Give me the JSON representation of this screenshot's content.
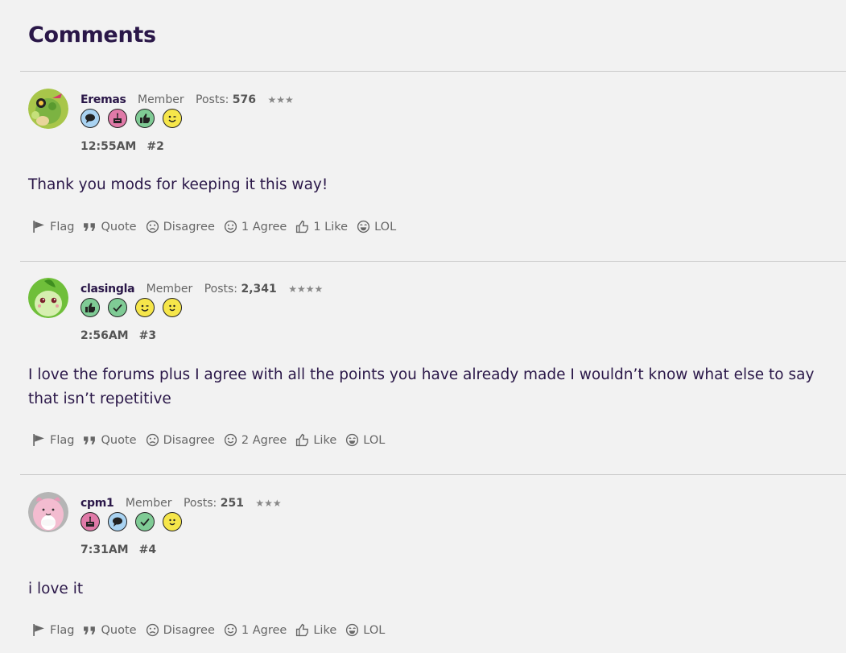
{
  "heading": "Comments",
  "comments": [
    {
      "username": "Eremas",
      "role": "Member",
      "posts_label": "Posts:",
      "posts_count": "576",
      "stars": "★★★",
      "badges": [
        "speech-bubble-icon",
        "cake-icon",
        "thumbs-up-icon",
        "wink-icon"
      ],
      "time": "12:55AM",
      "number": "#2",
      "body": "Thank you mods for keeping it this way!",
      "actions": {
        "flag": "Flag",
        "quote": "Quote",
        "disagree": "Disagree",
        "agree": "1 Agree",
        "like": "1 Like",
        "lol": "LOL"
      }
    },
    {
      "username": "clasingla",
      "role": "Member",
      "posts_label": "Posts:",
      "posts_count": "2,341",
      "stars": "★★★★",
      "badges": [
        "thumbs-up-icon",
        "checkmark-icon",
        "wink-icon",
        "smile-icon"
      ],
      "time": "2:56AM",
      "number": "#3",
      "body": "I love the forums plus I agree with all the points you have already made I wouldn’t know what else to say that isn’t repetitive",
      "actions": {
        "flag": "Flag",
        "quote": "Quote",
        "disagree": "Disagree",
        "agree": "2 Agree",
        "like": "Like",
        "lol": "LOL"
      }
    },
    {
      "username": "cpm1",
      "role": "Member",
      "posts_label": "Posts:",
      "posts_count": "251",
      "stars": "★★★",
      "badges": [
        "cake-icon",
        "speech-bubble-icon",
        "checkmark-icon",
        "smile-icon"
      ],
      "time": "7:31AM",
      "number": "#4",
      "body": "i love it",
      "actions": {
        "flag": "Flag",
        "quote": "Quote",
        "disagree": "Disagree",
        "agree": "1 Agree",
        "like": "Like",
        "lol": "LOL"
      }
    }
  ],
  "colors": {
    "text": "#2a1748",
    "muted": "#666666",
    "background": "#f2f2f2",
    "badge_blue": "#a9d3f2",
    "badge_pink": "#e07aa8",
    "badge_green": "#7fcb95",
    "badge_yellow": "#f6e64a"
  }
}
